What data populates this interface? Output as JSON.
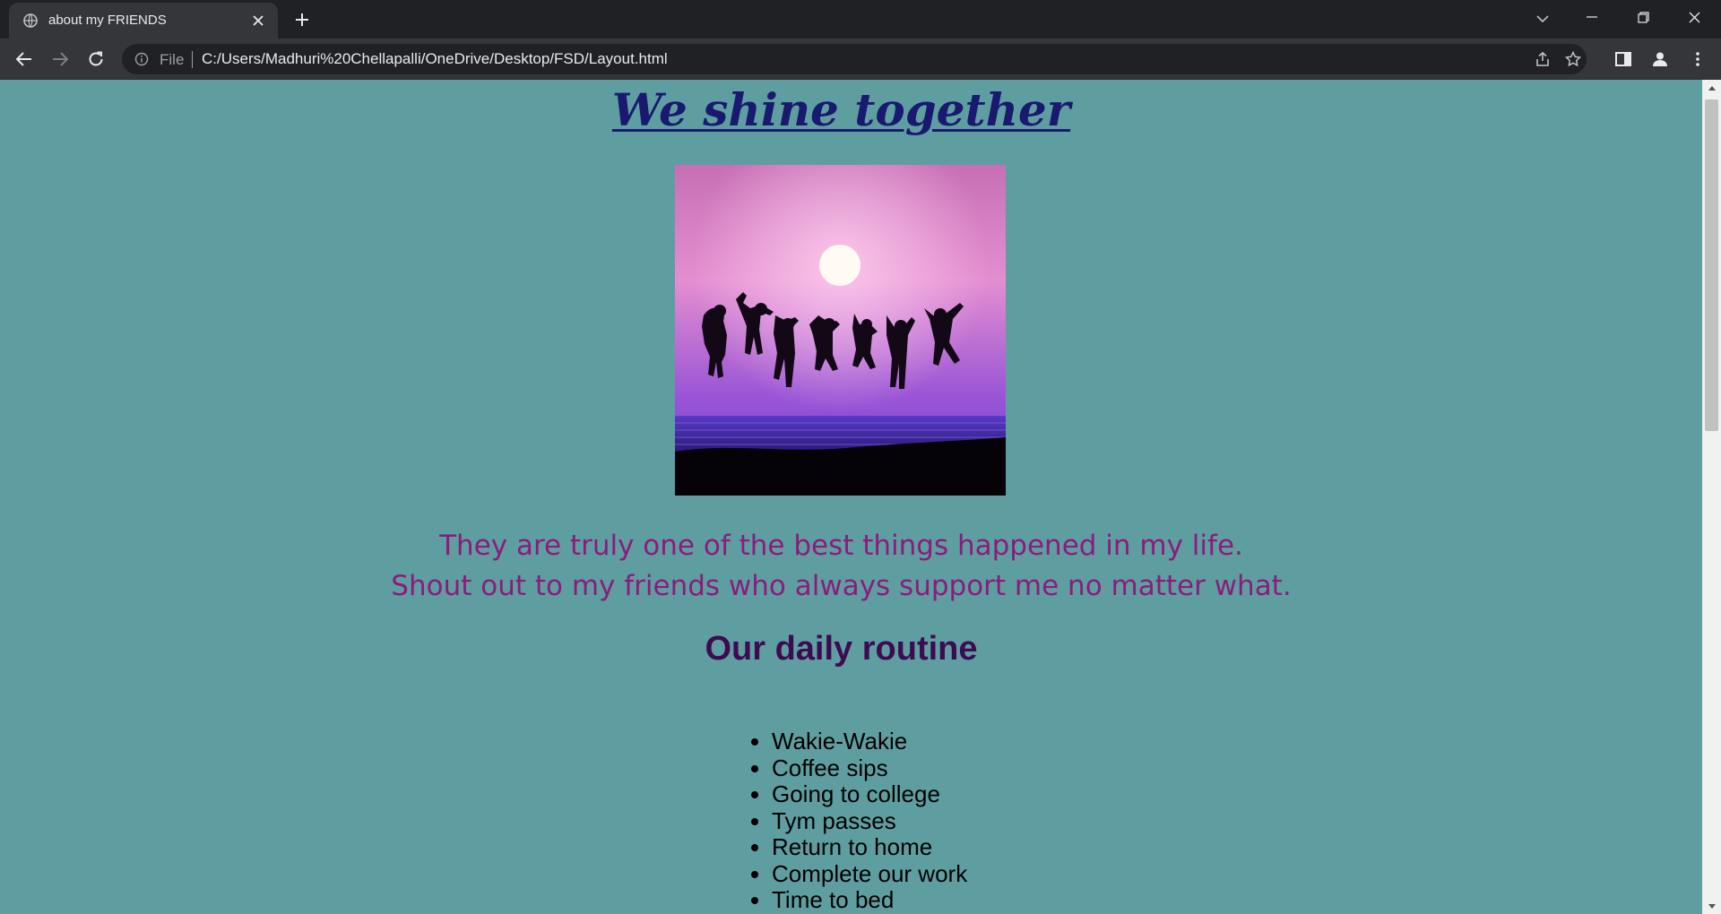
{
  "browser": {
    "tab_title": "about my FRIENDS",
    "url_scheme": "File",
    "url": "C:/Users/Madhuri%20Chellapalli/OneDrive/Desktop/FSD/Layout.html"
  },
  "page": {
    "heading": "We shine together",
    "image": {
      "description_icon": "friends-silhouette-sunset-image"
    },
    "quote_line1": "They are truly one of the best things happened in my life.",
    "quote_line2": "Shout out to my friends who always support me no matter what.",
    "routine_title": "Our daily routine",
    "routine_items": [
      "Wakie-Wakie",
      "Coffee sips",
      "Going to college",
      "Tym passes",
      "Return to home",
      "Complete our work",
      "Time to bed"
    ]
  },
  "colors": {
    "page_background": "#5f9ea0",
    "heading": "#191970",
    "quote": "#8b1c7c",
    "routine_title": "#3d0b52"
  }
}
